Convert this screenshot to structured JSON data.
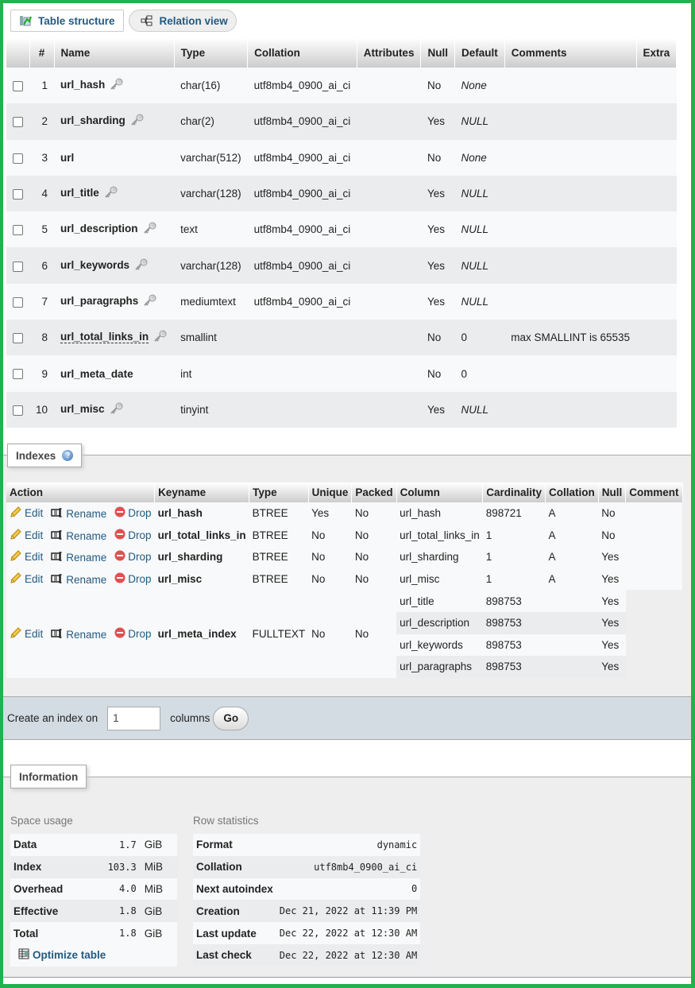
{
  "tabs": [
    {
      "label": "Table structure",
      "icon": "table-structure-icon"
    },
    {
      "label": "Relation view",
      "icon": "relation-view-icon"
    }
  ],
  "structure": {
    "headers": [
      "#",
      "Name",
      "Type",
      "Collation",
      "Attributes",
      "Null",
      "Default",
      "Comments",
      "Extra"
    ],
    "rows": [
      {
        "num": "1",
        "name": "url_hash",
        "key": true,
        "type": "char(16)",
        "collation": "utf8mb4_0900_ai_ci",
        "attributes": "",
        "null": "No",
        "default": "None",
        "default_italic": true,
        "comments": "",
        "extra": ""
      },
      {
        "num": "2",
        "name": "url_sharding",
        "key": true,
        "type": "char(2)",
        "collation": "utf8mb4_0900_ai_ci",
        "attributes": "",
        "null": "Yes",
        "default": "NULL",
        "default_italic": true,
        "comments": "",
        "extra": ""
      },
      {
        "num": "3",
        "name": "url",
        "key": false,
        "type": "varchar(512)",
        "collation": "utf8mb4_0900_ai_ci",
        "attributes": "",
        "null": "No",
        "default": "None",
        "default_italic": true,
        "comments": "",
        "extra": ""
      },
      {
        "num": "4",
        "name": "url_title",
        "key": true,
        "type": "varchar(128)",
        "collation": "utf8mb4_0900_ai_ci",
        "attributes": "",
        "null": "Yes",
        "default": "NULL",
        "default_italic": true,
        "comments": "",
        "extra": ""
      },
      {
        "num": "5",
        "name": "url_description",
        "key": true,
        "type": "text",
        "collation": "utf8mb4_0900_ai_ci",
        "attributes": "",
        "null": "Yes",
        "default": "NULL",
        "default_italic": true,
        "comments": "",
        "extra": ""
      },
      {
        "num": "6",
        "name": "url_keywords",
        "key": true,
        "type": "varchar(128)",
        "collation": "utf8mb4_0900_ai_ci",
        "attributes": "",
        "null": "Yes",
        "default": "NULL",
        "default_italic": true,
        "comments": "",
        "extra": ""
      },
      {
        "num": "7",
        "name": "url_paragraphs",
        "key": true,
        "type": "mediumtext",
        "collation": "utf8mb4_0900_ai_ci",
        "attributes": "",
        "null": "Yes",
        "default": "NULL",
        "default_italic": true,
        "comments": "",
        "extra": ""
      },
      {
        "num": "8",
        "name": "url_total_links_in",
        "key": true,
        "dashed": true,
        "type": "smallint",
        "collation": "",
        "attributes": "",
        "null": "No",
        "default": "0",
        "default_italic": false,
        "comments": "max SMALLINT is 65535",
        "extra": ""
      },
      {
        "num": "9",
        "name": "url_meta_date",
        "key": false,
        "type": "int",
        "collation": "",
        "attributes": "",
        "null": "No",
        "default": "0",
        "default_italic": false,
        "comments": "",
        "extra": ""
      },
      {
        "num": "10",
        "name": "url_misc",
        "key": true,
        "type": "tinyint",
        "collation": "",
        "attributes": "",
        "null": "Yes",
        "default": "NULL",
        "default_italic": true,
        "comments": "",
        "extra": ""
      }
    ]
  },
  "indexes": {
    "legend": "Indexes",
    "headers": [
      "Action",
      "Keyname",
      "Type",
      "Unique",
      "Packed",
      "Column",
      "Cardinality",
      "Collation",
      "Null",
      "Comment"
    ],
    "actions": {
      "edit": "Edit",
      "rename": "Rename",
      "drop": "Drop"
    },
    "rows": [
      {
        "keyname": "url_hash",
        "type": "BTREE",
        "unique": "Yes",
        "packed": "No",
        "columns": [
          {
            "column": "url_hash",
            "cardinality": "898721",
            "collation": "A",
            "null": "No"
          }
        ],
        "comment": ""
      },
      {
        "keyname": "url_total_links_in",
        "type": "BTREE",
        "unique": "No",
        "packed": "No",
        "columns": [
          {
            "column": "url_total_links_in",
            "cardinality": "1",
            "collation": "A",
            "null": "No"
          }
        ],
        "comment": ""
      },
      {
        "keyname": "url_sharding",
        "type": "BTREE",
        "unique": "No",
        "packed": "No",
        "columns": [
          {
            "column": "url_sharding",
            "cardinality": "1",
            "collation": "A",
            "null": "Yes"
          }
        ],
        "comment": ""
      },
      {
        "keyname": "url_misc",
        "type": "BTREE",
        "unique": "No",
        "packed": "No",
        "columns": [
          {
            "column": "url_misc",
            "cardinality": "1",
            "collation": "A",
            "null": "Yes"
          }
        ],
        "comment": ""
      },
      {
        "keyname": "url_meta_index",
        "type": "FULLTEXT",
        "unique": "No",
        "packed": "No",
        "columns": [
          {
            "column": "url_title",
            "cardinality": "898753",
            "collation": "",
            "null": "Yes"
          },
          {
            "column": "url_description",
            "cardinality": "898753",
            "collation": "",
            "null": "Yes"
          },
          {
            "column": "url_keywords",
            "cardinality": "898753",
            "collation": "",
            "null": "Yes"
          },
          {
            "column": "url_paragraphs",
            "cardinality": "898753",
            "collation": "",
            "null": "Yes"
          }
        ],
        "comment": ""
      }
    ]
  },
  "create_index": {
    "label_before": "Create an index on",
    "value": "1",
    "label_after": "columns",
    "go": "Go"
  },
  "information": {
    "legend": "Information",
    "space_usage": {
      "title": "Space usage",
      "rows": [
        {
          "key": "Data",
          "value": "1.7",
          "unit": "GiB"
        },
        {
          "key": "Index",
          "value": "103.3",
          "unit": "MiB"
        },
        {
          "key": "Overhead",
          "value": "4.0",
          "unit": "MiB"
        },
        {
          "key": "Effective",
          "value": "1.8",
          "unit": "GiB"
        },
        {
          "key": "Total",
          "value": "1.8",
          "unit": "GiB"
        }
      ],
      "optimize": "Optimize table"
    },
    "row_statistics": {
      "title": "Row statistics",
      "rows": [
        {
          "key": "Format",
          "value": "dynamic"
        },
        {
          "key": "Collation",
          "value": "utf8mb4_0900_ai_ci"
        },
        {
          "key": "Next autoindex",
          "value": "0"
        },
        {
          "key": "Creation",
          "value": "Dec 21, 2022 at 11:39 PM"
        },
        {
          "key": "Last update",
          "value": "Dec 22, 2022 at 12:30 AM"
        },
        {
          "key": "Last check",
          "value": "Dec 22, 2022 at 12:30 AM"
        }
      ]
    }
  },
  "colors": {
    "link": "#235a81",
    "frame": "#22b14c",
    "create_bar": "#d3dce3"
  }
}
